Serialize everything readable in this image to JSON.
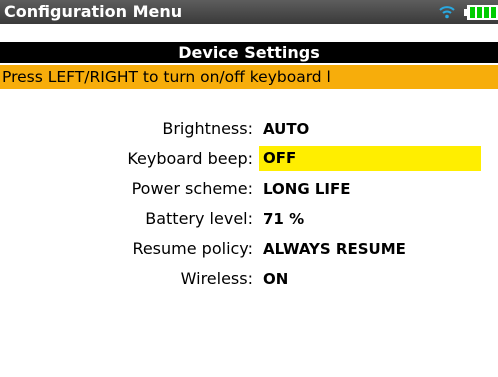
{
  "window": {
    "title": "Configuration Menu",
    "icons": [
      "wifi-icon",
      "battery-icon"
    ]
  },
  "header": {
    "title": "Device Settings"
  },
  "hint": {
    "text": "Press LEFT/RIGHT to turn on/off keyboard l"
  },
  "settings": [
    {
      "label": "Brightness:",
      "value": "AUTO",
      "selected": false
    },
    {
      "label": "Keyboard beep:",
      "value": "OFF",
      "selected": true
    },
    {
      "label": "Power scheme:",
      "value": "LONG LIFE",
      "selected": false
    },
    {
      "label": "Battery level:",
      "value": "71 %",
      "selected": false
    },
    {
      "label": "Resume policy:",
      "value": "ALWAYS RESUME",
      "selected": false
    },
    {
      "label": "Wireless:",
      "value": "ON",
      "selected": false
    }
  ],
  "colors": {
    "title_bar": "#4a4a4a",
    "header_bar": "#000000",
    "hint_bar": "#f7ad0b",
    "selection": "#ffee00",
    "wifi": "#29a8e0",
    "battery": "#00cc00"
  }
}
